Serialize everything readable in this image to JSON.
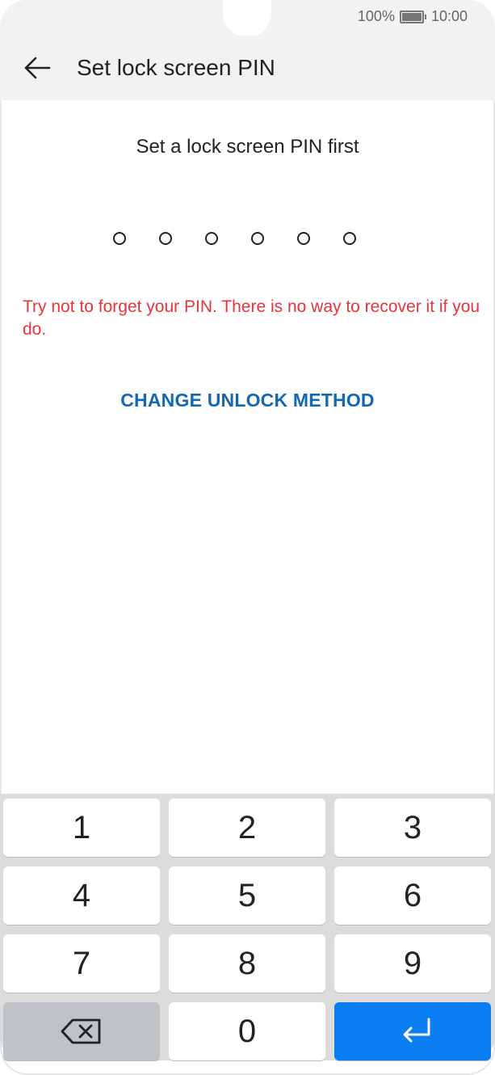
{
  "status": {
    "battery": "100%",
    "time": "10:00"
  },
  "appbar": {
    "title": "Set lock screen PIN"
  },
  "main": {
    "subtitle": "Set a lock screen PIN first",
    "pin_length": 6,
    "warning": "Try not to forget your PIN. There is no way to recover it if you do.",
    "change_method": "CHANGE UNLOCK METHOD"
  },
  "keypad": {
    "keys": [
      "1",
      "2",
      "3",
      "4",
      "5",
      "6",
      "7",
      "8",
      "9",
      "0"
    ],
    "backspace_icon": "backspace-icon",
    "enter_icon": "enter-icon",
    "colors": {
      "backspace_key": "#bfc3c8",
      "enter_key": "#0a7df2"
    }
  },
  "colors": {
    "warning": "#e6343a",
    "link": "#1467b3"
  }
}
